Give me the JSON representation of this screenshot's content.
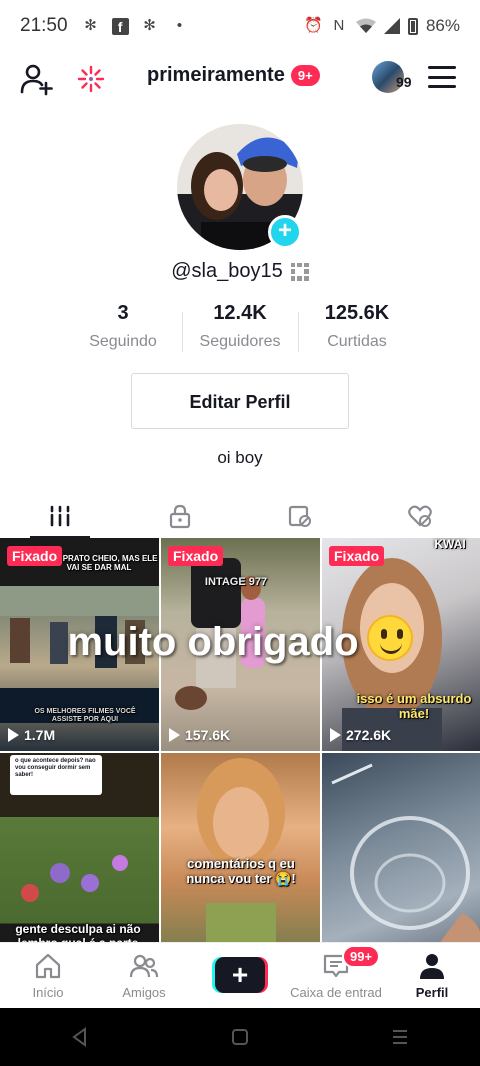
{
  "status_bar": {
    "time": "21:50",
    "battery": "86%",
    "icons": [
      "pinwheel-icon",
      "facebook-icon",
      "pinwheel-icon",
      "dot-icon",
      "alarm-icon",
      "nfc-icon",
      "wifi-icon",
      "signal-icon",
      "battery-icon"
    ]
  },
  "header": {
    "username": "primeiramente",
    "notification_badge": "9+",
    "avatar_count": "99"
  },
  "profile": {
    "handle": "@sla_boy15",
    "bio": "oi boy",
    "edit_button": "Editar Perfil"
  },
  "stats": [
    {
      "value": "3",
      "label": "Seguindo"
    },
    {
      "value": "12.4K",
      "label": "Seguidores"
    },
    {
      "value": "125.6K",
      "label": "Curtidas"
    }
  ],
  "tabs": [
    {
      "icon": "grid-icon",
      "active": true
    },
    {
      "icon": "lock-icon",
      "active": false
    },
    {
      "icon": "tagged-icon",
      "active": false
    },
    {
      "icon": "liked-icon",
      "active": false
    }
  ],
  "overlay_text": "muito obrigado",
  "videos": [
    {
      "pinned_label": "Fixado",
      "views": "1.7M",
      "caption_top": "E UM PRATO CHEIO, MAS ELE VAI SE DAR MAL",
      "caption_bottom": "OS MELHORES FILMES VOCÊ ASSISTE POR AQUI"
    },
    {
      "pinned_label": "Fixado",
      "views": "157.6K",
      "caption_top": "INTAGE 977",
      "caption_bottom": ""
    },
    {
      "pinned_label": "Fixado",
      "views": "272.6K",
      "caption_top": "KWAI",
      "caption_bottom": "isso é um absurdo mãe!"
    },
    {
      "pinned_label": "",
      "views": "",
      "caption_top": "o que acontece depois? nao vou conseguir dormir sem saber!",
      "caption_bottom": "gente desculpa ai não lembro qual é a parte"
    },
    {
      "pinned_label": "",
      "views": "",
      "caption_top": "",
      "caption_bottom": "comentários q eu nunca vou ter 😭!"
    },
    {
      "pinned_label": "",
      "views": "",
      "caption_top": "",
      "caption_bottom": ""
    }
  ],
  "bottom_nav": {
    "items": [
      {
        "label": "Início",
        "icon": "home-icon"
      },
      {
        "label": "Amigos",
        "icon": "friends-icon"
      },
      {
        "label": "",
        "icon": "create-icon"
      },
      {
        "label": "Caixa de entrad",
        "icon": "inbox-icon",
        "badge": "99+"
      },
      {
        "label": "Perfil",
        "icon": "profile-icon",
        "active": true
      }
    ]
  },
  "colors": {
    "accent_red": "#fe2c55",
    "accent_cyan": "#25f4ee",
    "add_circle": "#20d5ec",
    "text_primary": "#161823",
    "text_secondary": "#8a8b91"
  }
}
